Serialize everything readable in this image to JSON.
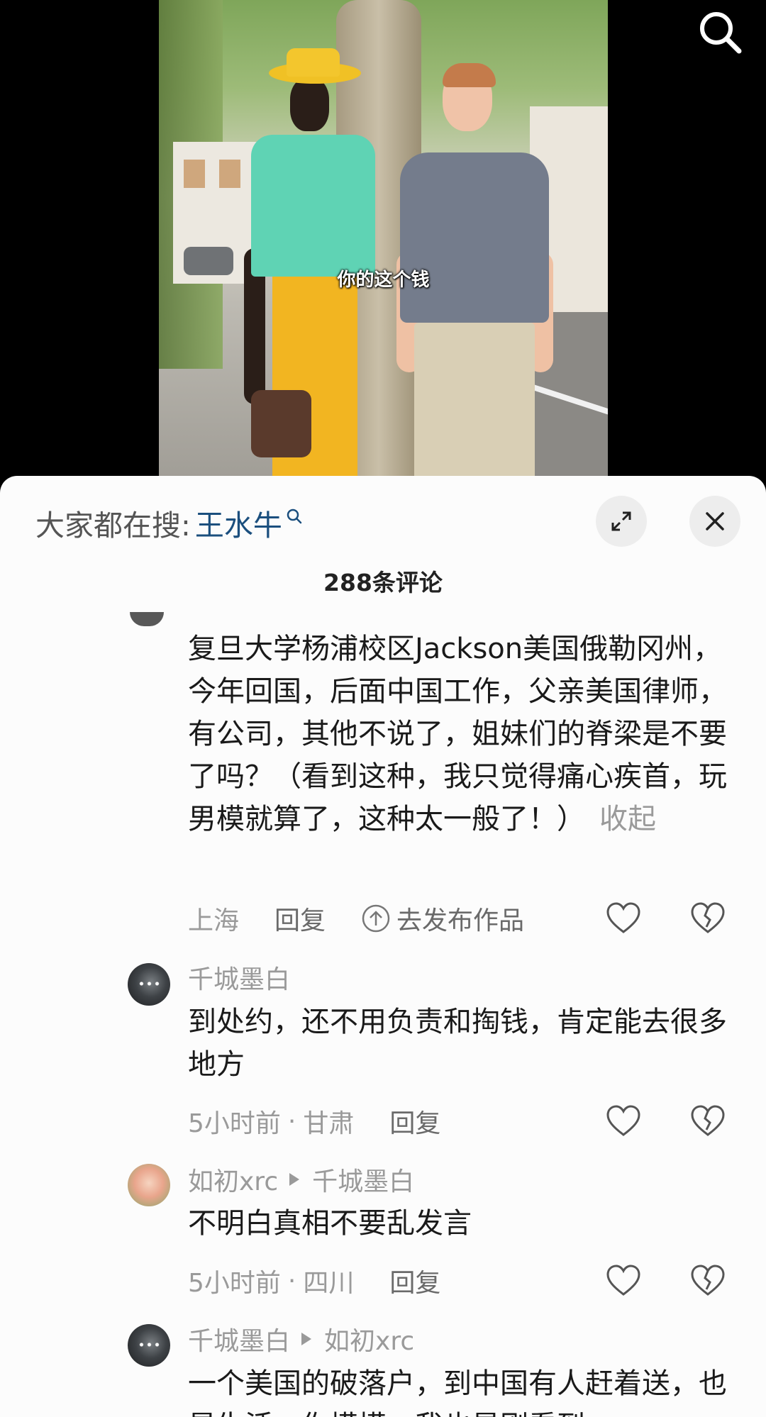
{
  "video": {
    "subtitle": "你的这个钱"
  },
  "top_bar": {
    "search_icon": "search-icon"
  },
  "sheet": {
    "hot_search_label": "大家都在搜:",
    "hot_search_term": "王水牛",
    "comment_count": "288条评论",
    "expand_icon": "expand-icon",
    "close_icon": "close-icon"
  },
  "comments": [
    {
      "text": "复旦大学杨浦校区Jackson美国俄勒冈州，今年回国，后面中国工作，父亲美国律师，有公司，其他不说了，姐妹们的脊梁是不要了吗？（看到这种，我只觉得痛心疾首，玩男模就算了，这种太一般了！）",
      "collapse": "收起",
      "location": "上海",
      "reply": "回复",
      "publish": "去发布作品"
    },
    {
      "author": "千城墨白",
      "text": "到处约，还不用负责和掏钱，肯定能去很多地方",
      "time": "5小时前",
      "location": "甘肃",
      "reply": "回复"
    },
    {
      "author": "如初xrc",
      "reply_to": "千城墨白",
      "text": "不明白真相不要乱发言",
      "time": "5小时前",
      "location": "四川",
      "reply": "回复"
    },
    {
      "author": "千城墨白",
      "reply_to": "如初xrc",
      "text": "一个美国的破落户，到中国有人赶着送，也是生活，你摸摸，我也是刚看到"
    }
  ],
  "colors": {
    "sheet_bg": "#fcfcfc",
    "hot_term": "#1b4f7e",
    "meta": "#9a9a9a",
    "text": "#1a1a1a"
  }
}
